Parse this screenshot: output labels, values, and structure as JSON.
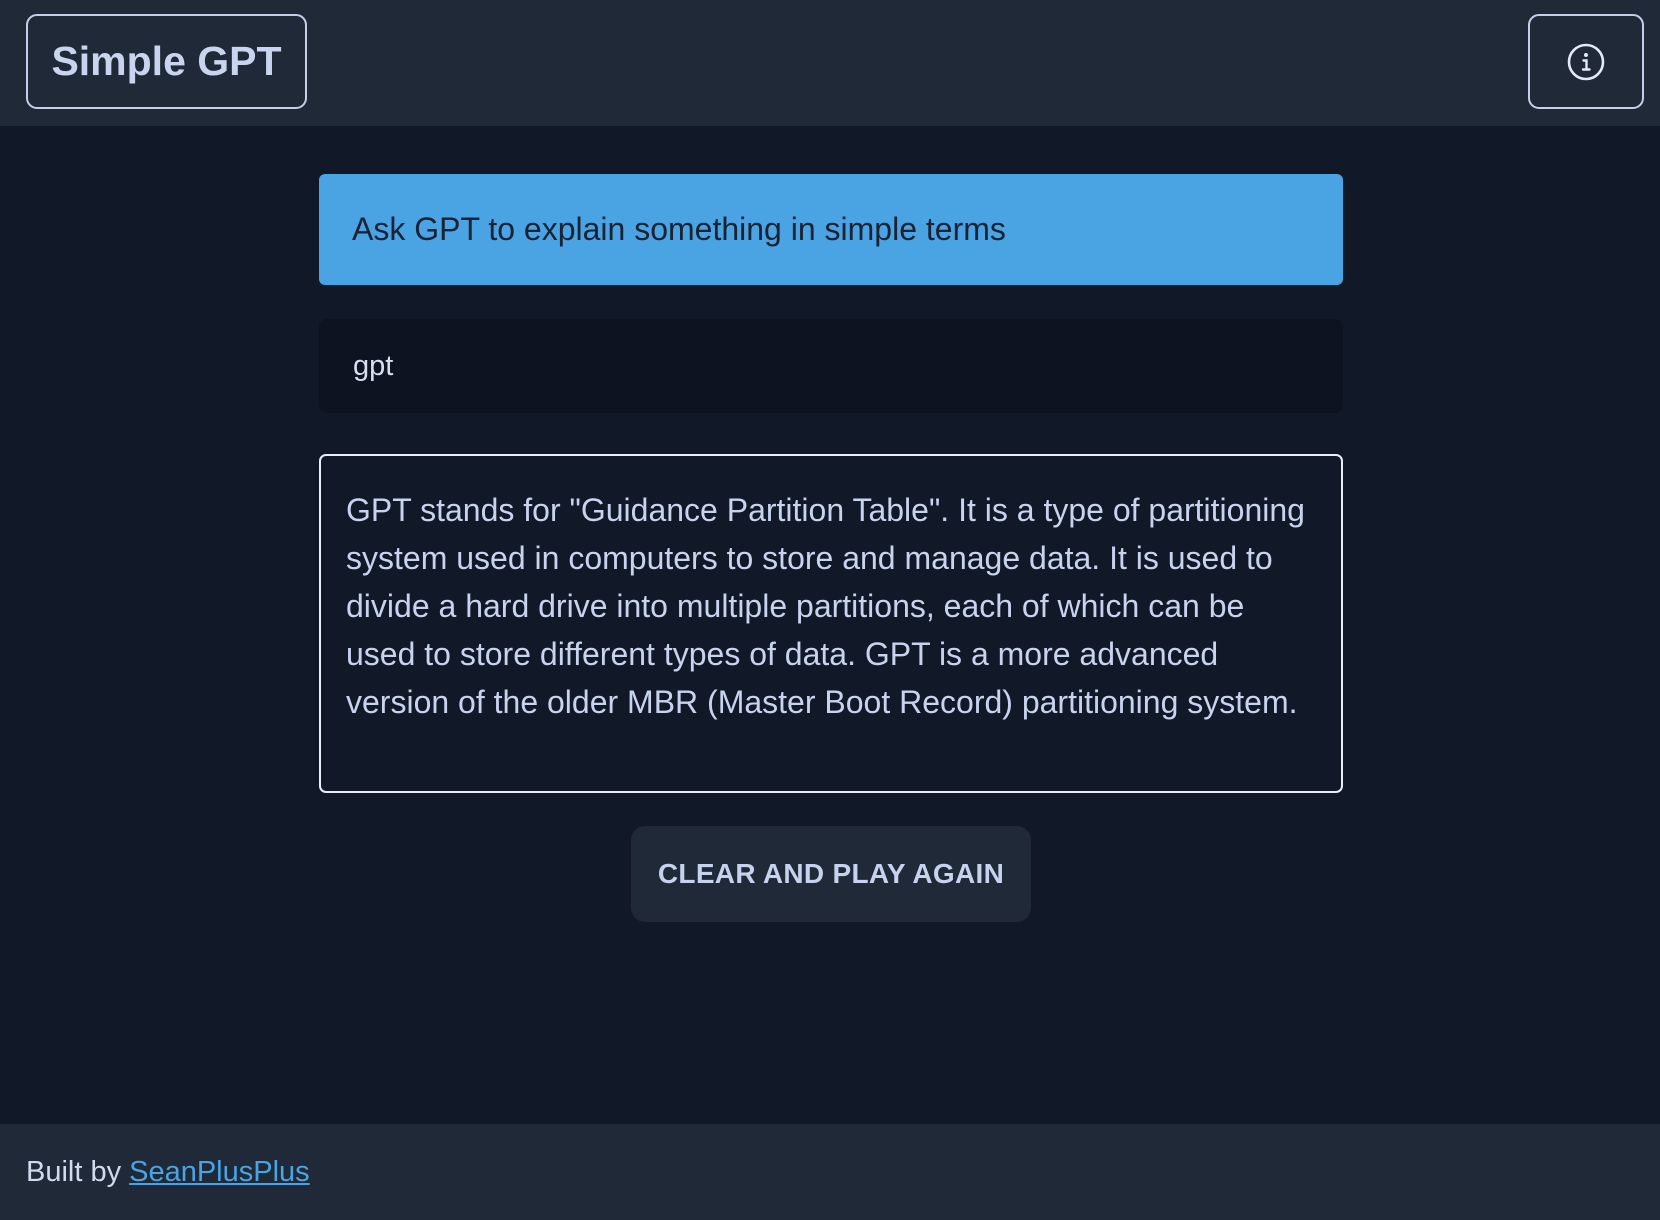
{
  "header": {
    "brand_label": "Simple GPT",
    "info_icon": "info-circle-icon"
  },
  "main": {
    "prompt_banner": "Ask GPT to explain something in simple terms",
    "query_value": "gpt",
    "answer_text": "GPT stands for \"Guidance Partition Table\". It is a type of partitioning system used in computers to store and manage data. It is used to divide a hard drive into multiple partitions, each of which can be used to store different types of data. GPT is a more advanced version of the older MBR (Master Boot Record) partitioning system.",
    "clear_button_label": "CLEAR AND PLAY AGAIN"
  },
  "footer": {
    "built_by_text": "Built by",
    "author_link_label": "SeanPlusPlus"
  },
  "colors": {
    "background": "#111827",
    "panel": "#1f2937",
    "accent": "#4aa3e3",
    "text": "#c3cfeb"
  }
}
